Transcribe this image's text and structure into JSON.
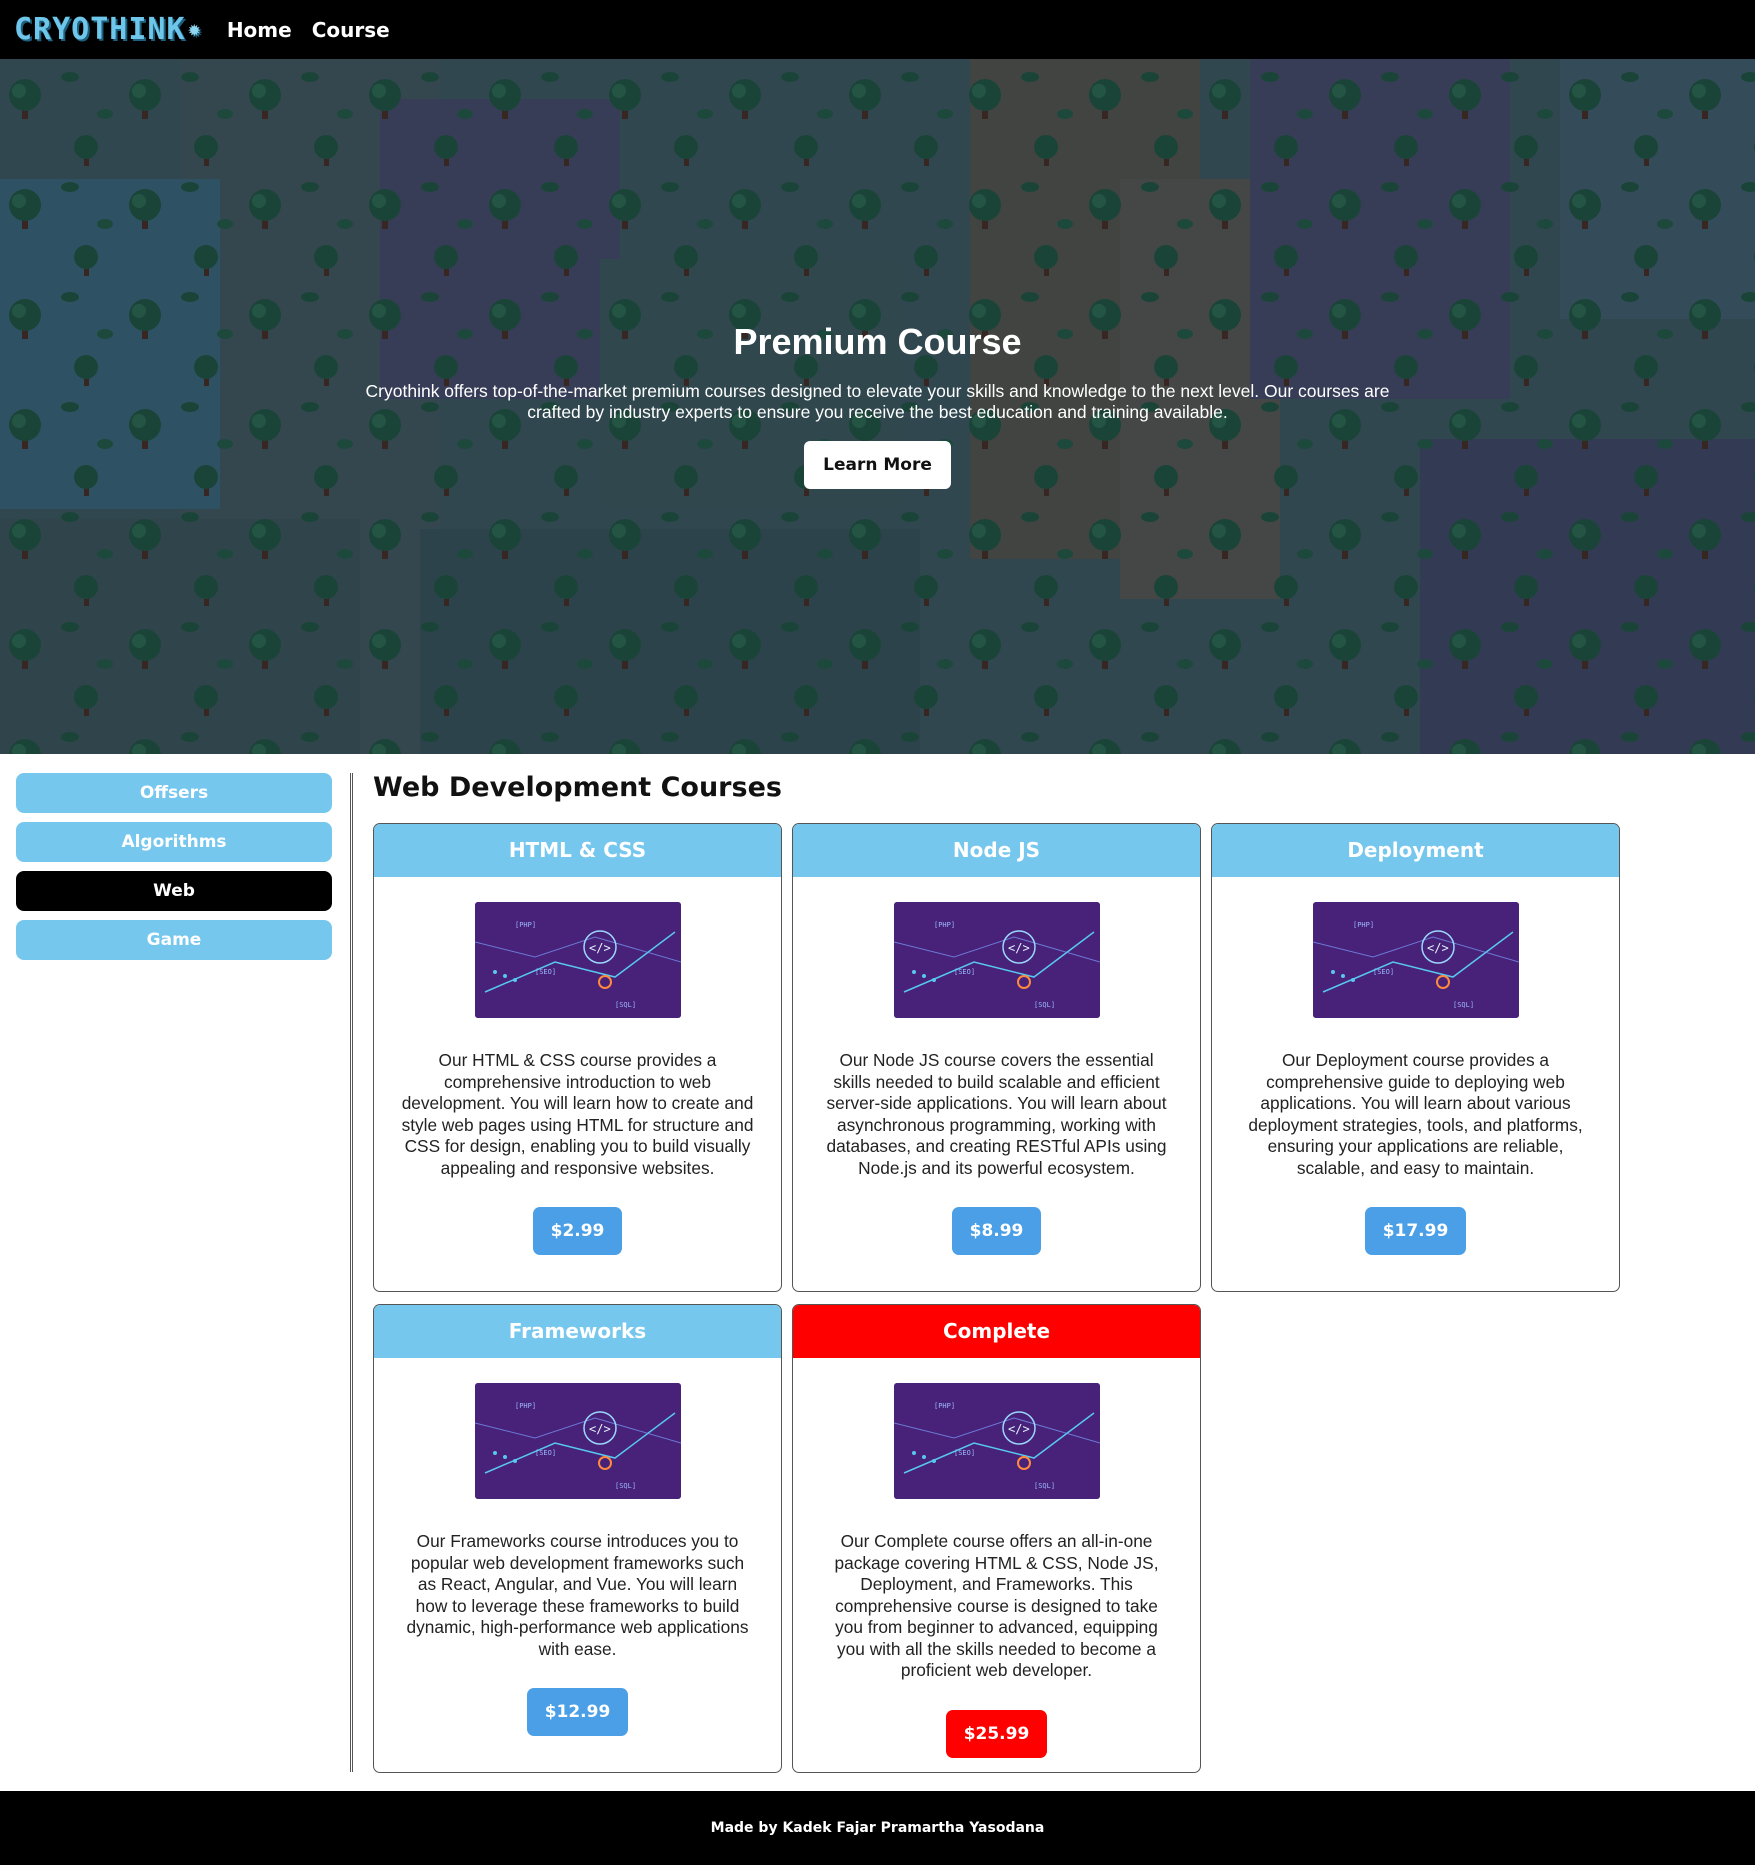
{
  "navbar": {
    "logo": "CRYOTHINK",
    "links": [
      "Home",
      "Course"
    ]
  },
  "hero": {
    "title": "Premium Course",
    "description": "Cryothink offers top-of-the-market premium courses designed to elevate your skills and knowledge to the next level. Our courses are crafted by industry experts to ensure you receive the best education and training available.",
    "button": "Learn More"
  },
  "sidebar": {
    "items": [
      {
        "label": "Offsers",
        "active": false
      },
      {
        "label": "Algorithms",
        "active": false
      },
      {
        "label": "Web",
        "active": true
      },
      {
        "label": "Game",
        "active": false
      }
    ]
  },
  "main": {
    "title": "Web Development Courses",
    "courses": [
      {
        "title": "HTML & CSS",
        "description": "Our HTML & CSS course provides a comprehensive introduction to web development. You will learn how to create and style web pages using HTML for structure and CSS for design, enabling you to build visually appealing and responsive websites.",
        "price": "$2.99",
        "accent": "#76c7ee"
      },
      {
        "title": "Node JS",
        "description": "Our Node JS course covers the essential skills needed to build scalable and efficient server-side applications. You will learn about asynchronous programming, working with databases, and creating RESTful APIs using Node.js and its powerful ecosystem.",
        "price": "$8.99",
        "accent": "#76c7ee"
      },
      {
        "title": "Deployment",
        "description": "Our Deployment course provides a comprehensive guide to deploying web applications. You will learn about various deployment strategies, tools, and platforms, ensuring your applications are reliable, scalable, and easy to maintain.",
        "price": "$17.99",
        "accent": "#76c7ee"
      },
      {
        "title": "Frameworks",
        "description": "Our Frameworks course introduces you to popular web development frameworks such as React, Angular, and Vue. You will learn how to leverage these frameworks to build dynamic, high-performance web applications with ease.",
        "price": "$12.99",
        "accent": "#76c7ee"
      },
      {
        "title": "Complete",
        "description": "Our Complete course offers an all-in-one package covering HTML & CSS, Node JS, Deployment, and Frameworks. This comprehensive course is designed to take you from beginner to advanced, equipping you with all the skills needed to become a proficient web developer.",
        "price": "$25.99",
        "accent": "#ff0000"
      }
    ]
  },
  "footer": {
    "text": "Made by Kadek Fajar Pramartha Yasodana"
  },
  "colors": {
    "accent_blue": "#76c7ee",
    "price_blue": "#4a9fe6",
    "complete_red": "#ff0000",
    "nav_bg": "#000000"
  }
}
